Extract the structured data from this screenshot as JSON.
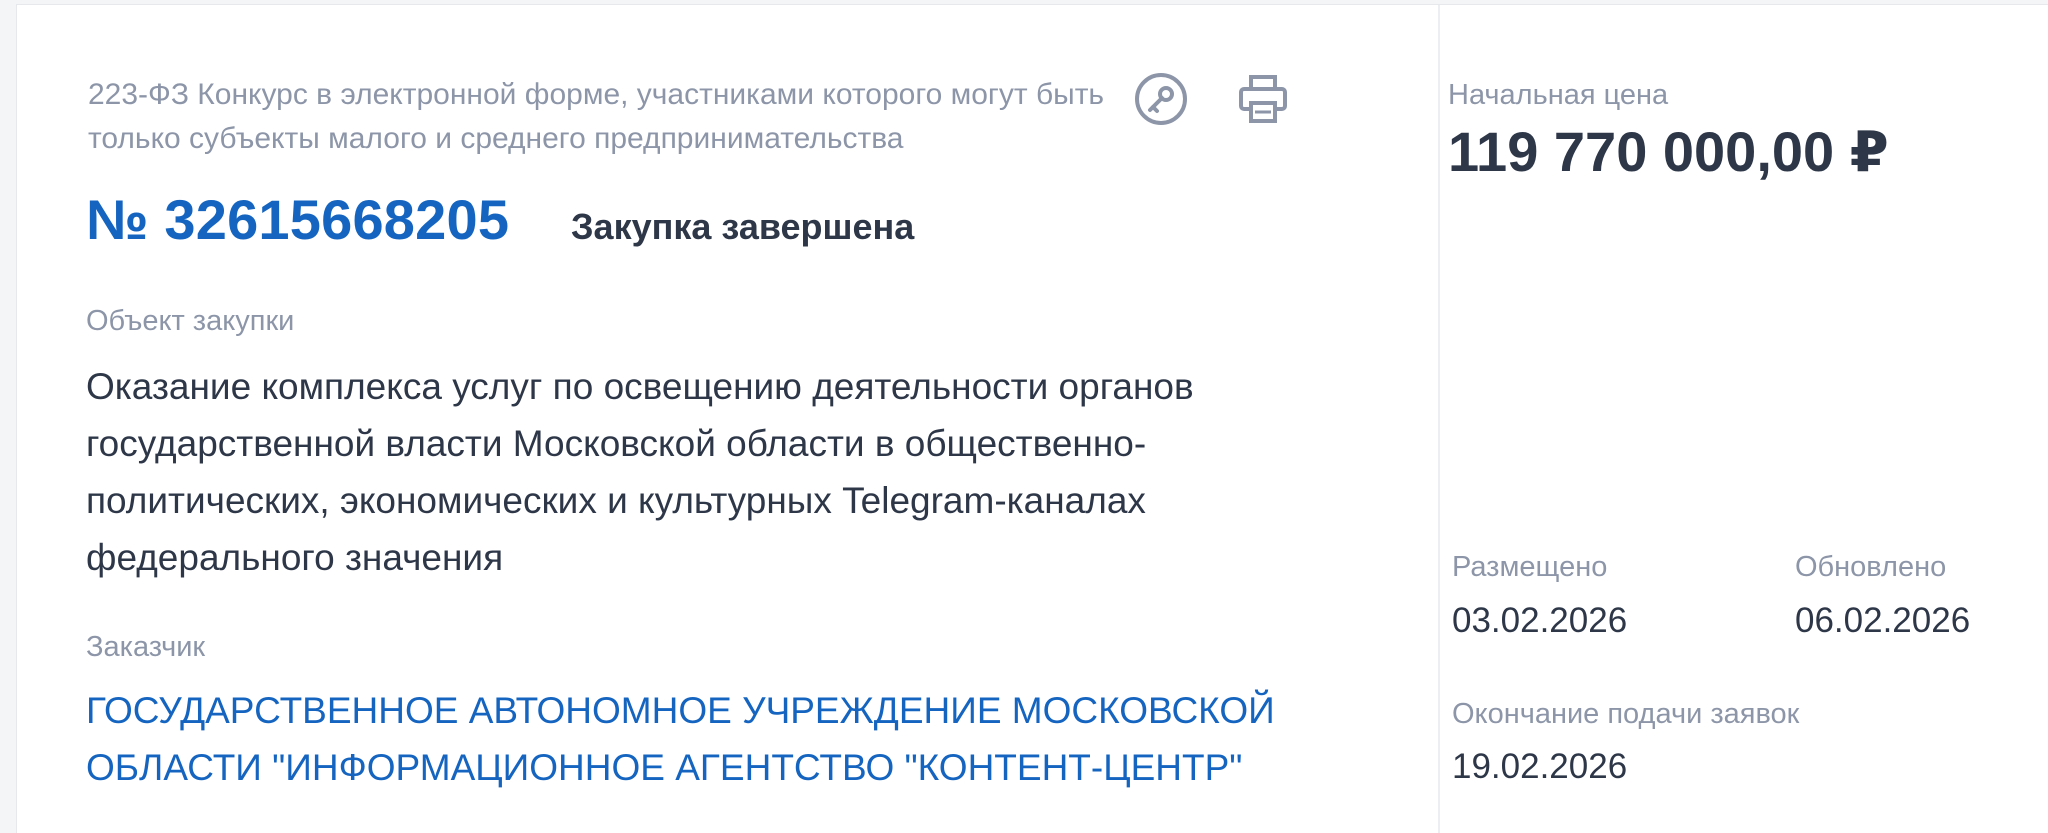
{
  "procurement": {
    "law_type": "223-ФЗ Конкурс в электронной форме, участниками которого могут быть только субъекты малого и среднего предпринимательства",
    "number": "№ 32615668205",
    "status": "Закупка завершена",
    "subject_label": "Объект закупки",
    "subject_text": "Оказание комплекса услуг по освещению деятельности органов государственной власти Московской области в общественно-политических, экономических и культурных Telegram-каналах федерального значения",
    "customer_label": "Заказчик",
    "customer_name": "ГОСУДАРСТВЕННОЕ АВТОНОМНОЕ УЧРЕЖДЕНИЕ МОСКОВСКОЙ ОБЛАСТИ \"ИНФОРМАЦИОННОЕ АГЕНТСТВО \"КОНТЕНТ-ЦЕНТР\""
  },
  "actions": {
    "key_icon": "key-icon",
    "print_icon": "printer-icon"
  },
  "summary": {
    "price_label": "Начальная цена",
    "price_value": "119 770 000,00 ₽",
    "posted_label": "Размещено",
    "posted_value": "03.02.2026",
    "updated_label": "Обновлено",
    "updated_value": "06.02.2026",
    "deadline_label": "Окончание подачи заявок",
    "deadline_value": "19.02.2026"
  },
  "colors": {
    "accent": "#1565c0",
    "text": "#2d3748",
    "muted": "#8c96a8"
  }
}
